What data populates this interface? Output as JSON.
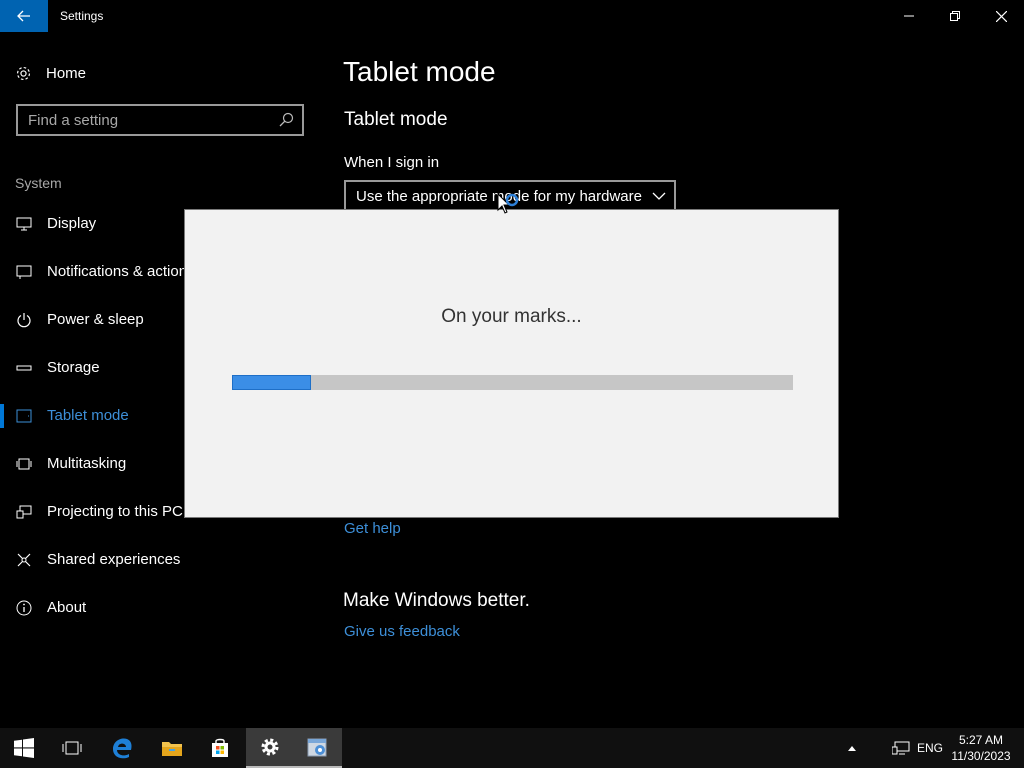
{
  "window": {
    "title": "Settings"
  },
  "sidebar": {
    "home_label": "Home",
    "search_placeholder": "Find a setting",
    "section_label": "System",
    "items": [
      {
        "label": "Display",
        "icon": "monitor-icon"
      },
      {
        "label": "Notifications & actions",
        "icon": "notifications-icon"
      },
      {
        "label": "Power & sleep",
        "icon": "power-icon"
      },
      {
        "label": "Storage",
        "icon": "storage-icon"
      },
      {
        "label": "Tablet mode",
        "icon": "tablet-icon",
        "active": true
      },
      {
        "label": "Multitasking",
        "icon": "multitasking-icon"
      },
      {
        "label": "Projecting to this PC",
        "icon": "projecting-icon"
      },
      {
        "label": "Shared experiences",
        "icon": "shared-icon"
      },
      {
        "label": "About",
        "icon": "info-icon"
      }
    ]
  },
  "content": {
    "page_title": "Tablet mode",
    "section_title": "Tablet mode",
    "when_sign_in_label": "When I sign in",
    "sign_in_dropdown_value": "Use the appropriate mode for my hardware",
    "get_help": "Get help",
    "make_better": "Make Windows better.",
    "feedback_link": "Give us feedback"
  },
  "dialog": {
    "message": "On your marks...",
    "progress": 0.14
  },
  "taskbar": {
    "language": "ENG",
    "time": "5:27 AM",
    "date": "11/30/2023",
    "apps": [
      "start-icon",
      "task-view-icon",
      "edge-icon",
      "file-explorer-icon",
      "store-icon",
      "settings-icon",
      "app-icon"
    ]
  },
  "colors": {
    "accent": "#0078d7",
    "link": "#3d8fd8",
    "progress_fill": "#3b8ee6"
  }
}
